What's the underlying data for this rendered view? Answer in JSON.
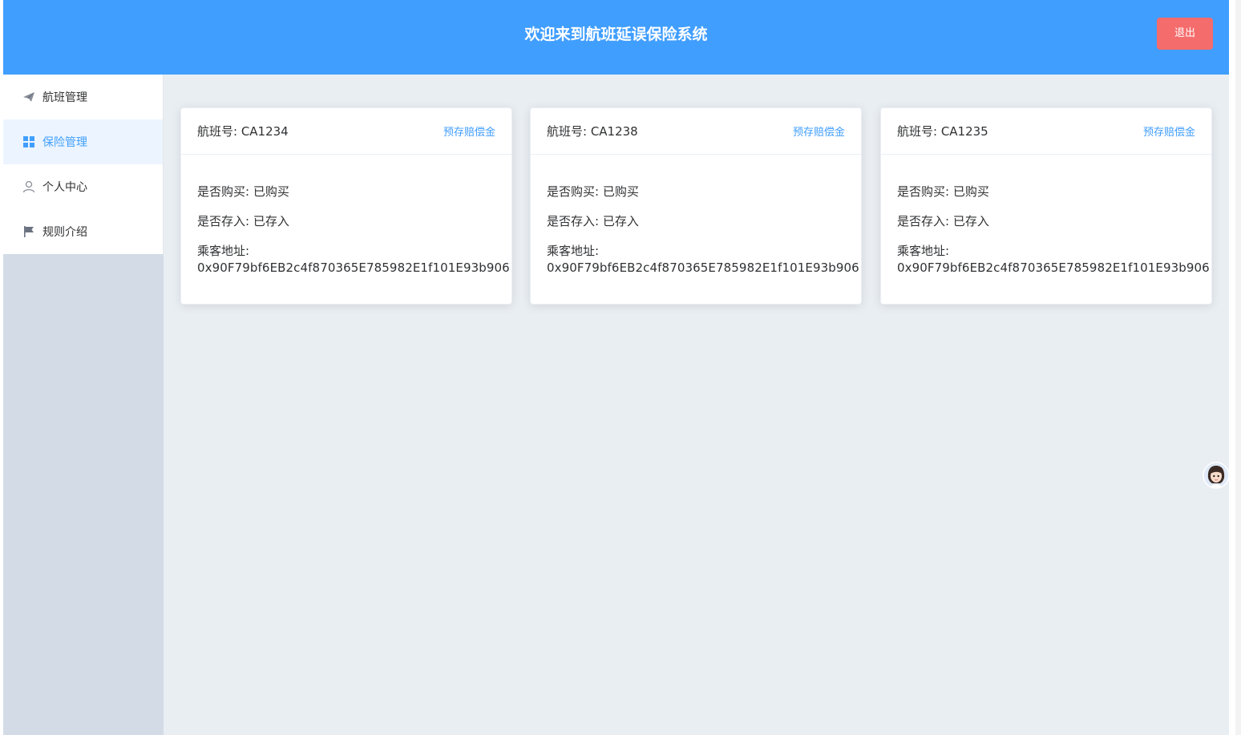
{
  "header": {
    "title": "欢迎来到航班延误保险系统",
    "logout_label": "退出"
  },
  "sidebar": {
    "items": [
      {
        "label": "航班管理",
        "icon": "paper-plane-icon",
        "active": false
      },
      {
        "label": "保险管理",
        "icon": "grid-icon",
        "active": true
      },
      {
        "label": "个人中心",
        "icon": "user-icon",
        "active": false
      },
      {
        "label": "规则介绍",
        "icon": "flag-icon",
        "active": false
      }
    ]
  },
  "cards": [
    {
      "flight_no": "航班号: CA1234",
      "action_label": "预存赔偿金",
      "purchased": "是否购买: 已购买",
      "deposited": "是否存入: 已存入",
      "address_label": "乘客地址:",
      "address": "0x90F79bf6EB2c4f870365E785982E1f101E93b906"
    },
    {
      "flight_no": "航班号: CA1238",
      "action_label": "预存赔偿金",
      "purchased": "是否购买: 已购买",
      "deposited": "是否存入: 已存入",
      "address_label": "乘客地址:",
      "address": "0x90F79bf6EB2c4f870365E785982E1f101E93b906"
    },
    {
      "flight_no": "航班号: CA1235",
      "action_label": "预存赔偿金",
      "purchased": "是否购买: 已购买",
      "deposited": "是否存入: 已存入",
      "address_label": "乘客地址:",
      "address": "0x90F79bf6EB2c4f870365E785982E1f101E93b906"
    }
  ],
  "colors": {
    "primary": "#409eff",
    "danger": "#f56c6c",
    "background": "#e9eef3",
    "sidebar_bg": "#d3dce6"
  }
}
